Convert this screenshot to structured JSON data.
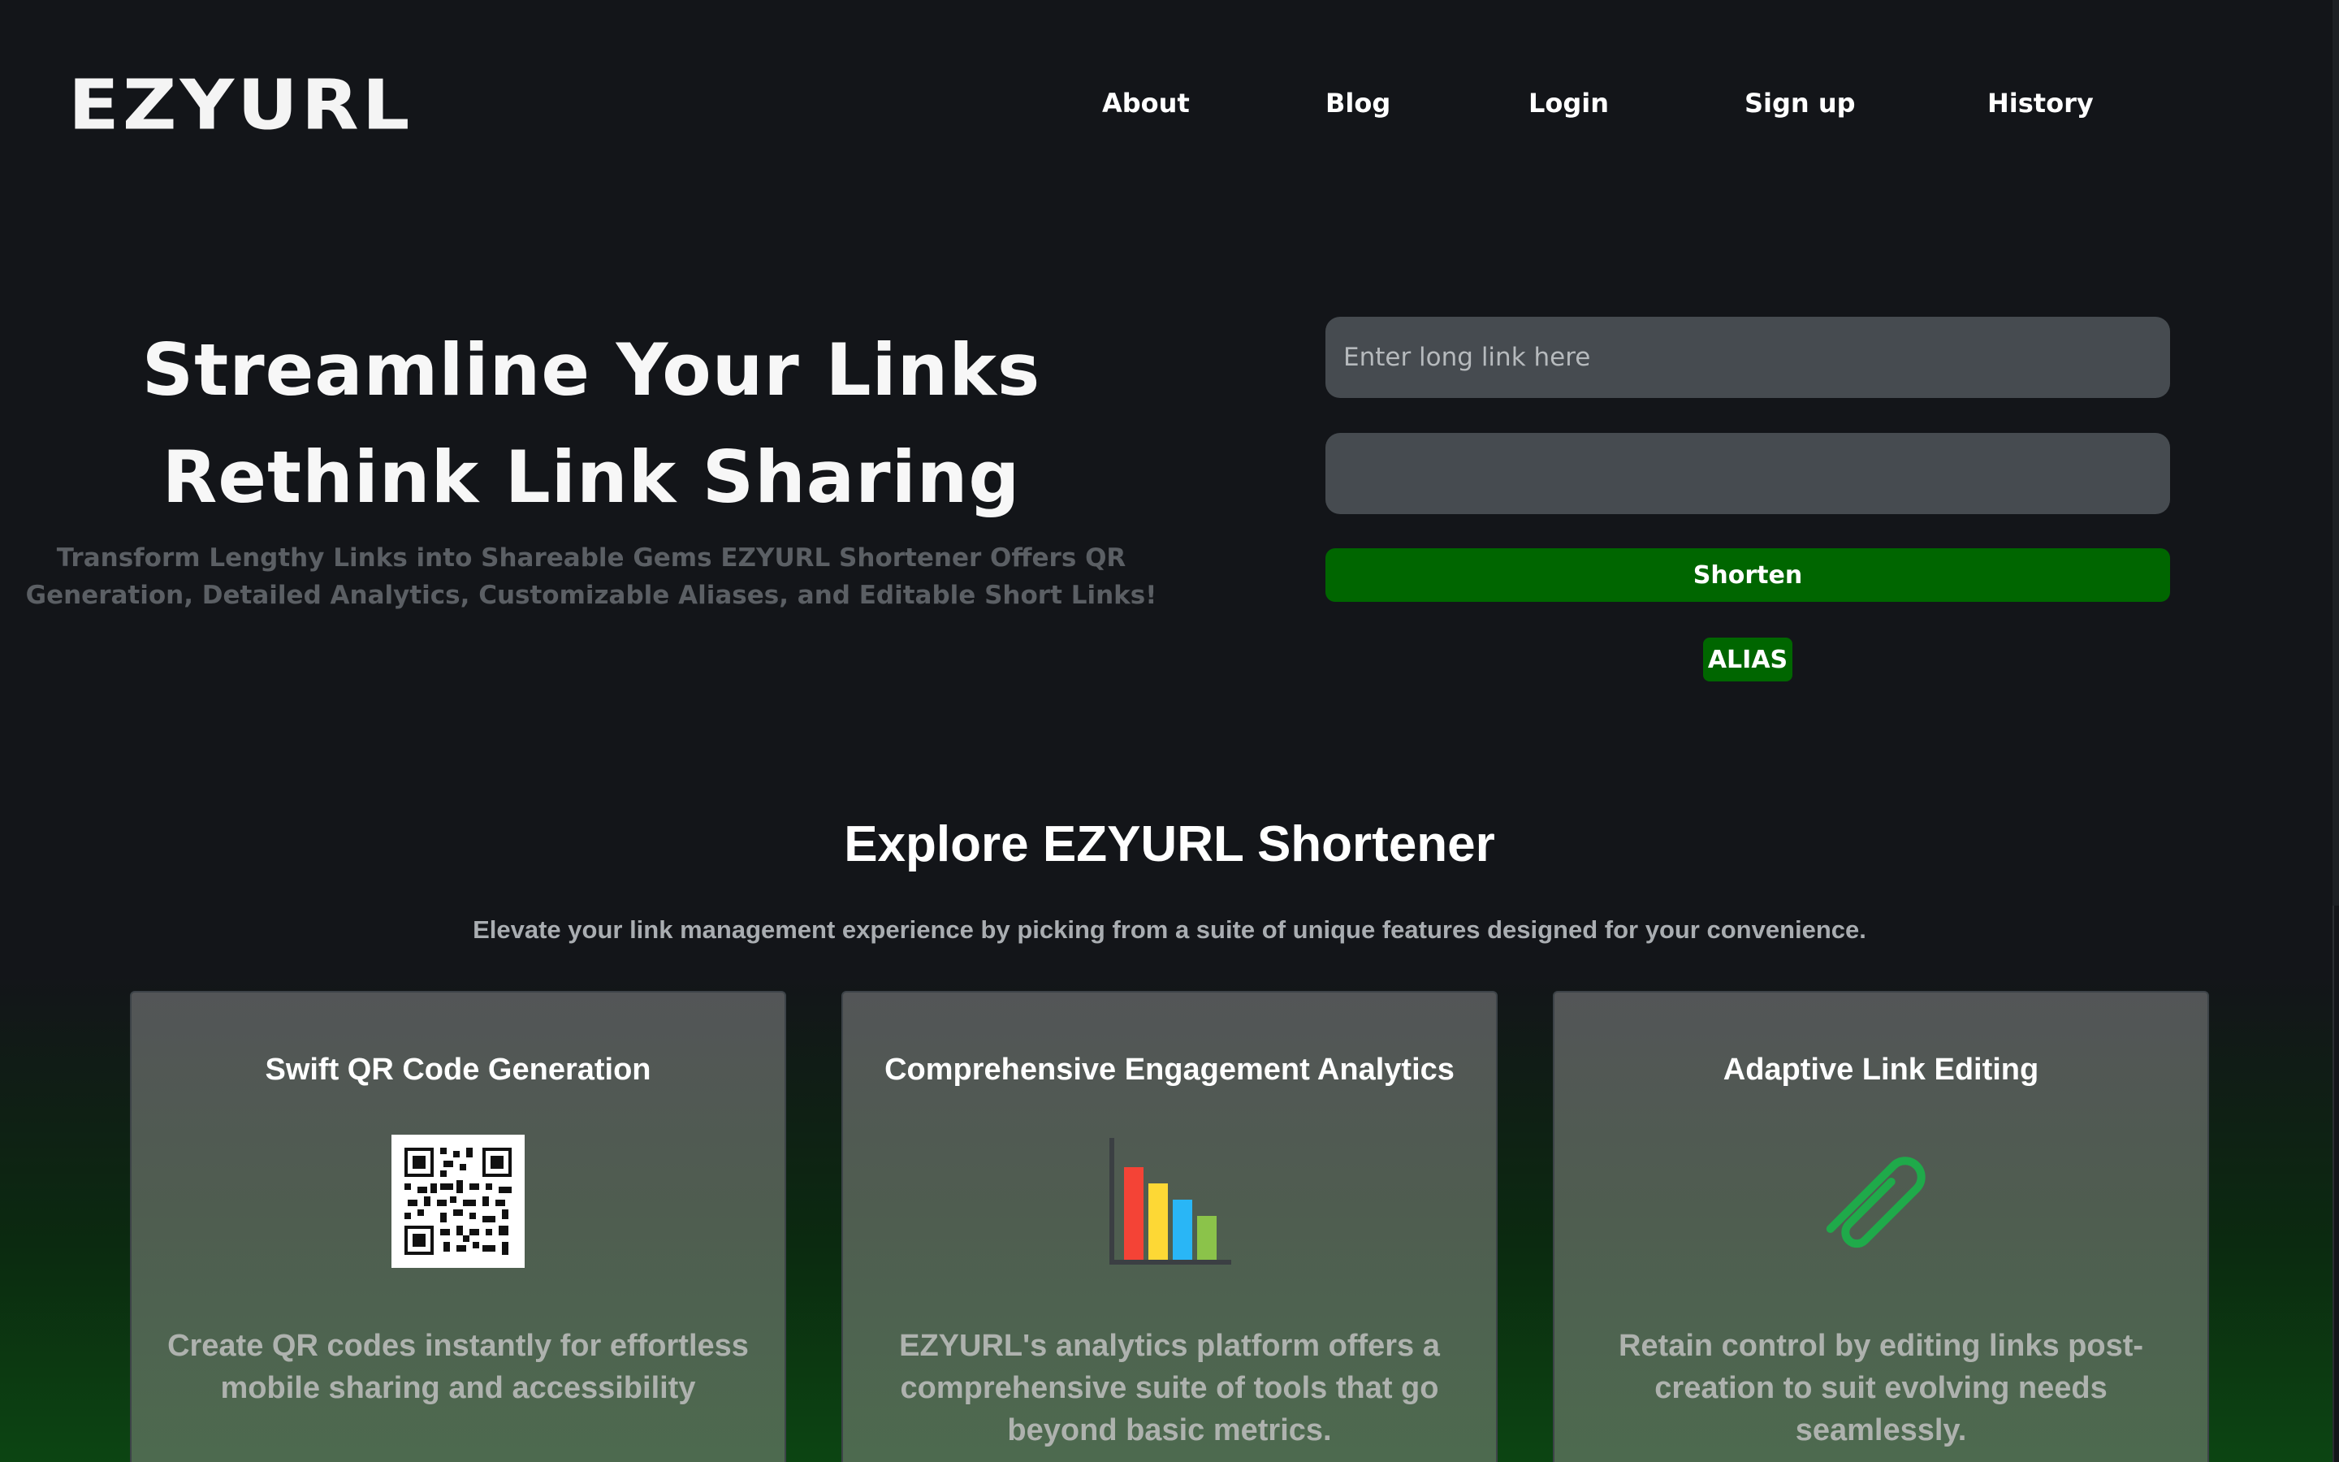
{
  "brand": {
    "logo": "EZYURL"
  },
  "nav": {
    "about": "About",
    "blog": "Blog",
    "login": "Login",
    "signup": "Sign up",
    "history": "History"
  },
  "hero": {
    "title_line1": "Streamline Your Links",
    "title_line2": "Rethink Link Sharing",
    "subtitle": "Transform Lengthy Links into Shareable Gems EZYURL Shortener Offers QR Generation, Detailed Analytics, Customizable Aliases, and Editable Short Links!"
  },
  "form": {
    "long_link_placeholder": "Enter long link here",
    "long_link_value": "",
    "alias_value": "",
    "shorten_label": "Shorten",
    "alias_label": "ALIAS"
  },
  "explore": {
    "title": "Explore EZYURL Shortener",
    "subtitle": "Elevate your link management experience by picking from a suite of unique features designed for your convenience."
  },
  "features": [
    {
      "title": "Swift QR Code Generation",
      "icon": "qr-code-icon",
      "description": "Create QR codes instantly for effortless mobile sharing and accessibility"
    },
    {
      "title": "Comprehensive Engagement Analytics",
      "icon": "bar-chart-icon",
      "description": "EZYURL's analytics platform offers a comprehensive suite of tools that go beyond basic metrics."
    },
    {
      "title": "Adaptive Link Editing",
      "icon": "paperclip-icon",
      "description": "Retain control by editing links post-creation to suit evolving needs seamlessly."
    }
  ],
  "colors": {
    "background": "#131519",
    "accent_green": "#006600",
    "input_bg": "#464b50"
  }
}
